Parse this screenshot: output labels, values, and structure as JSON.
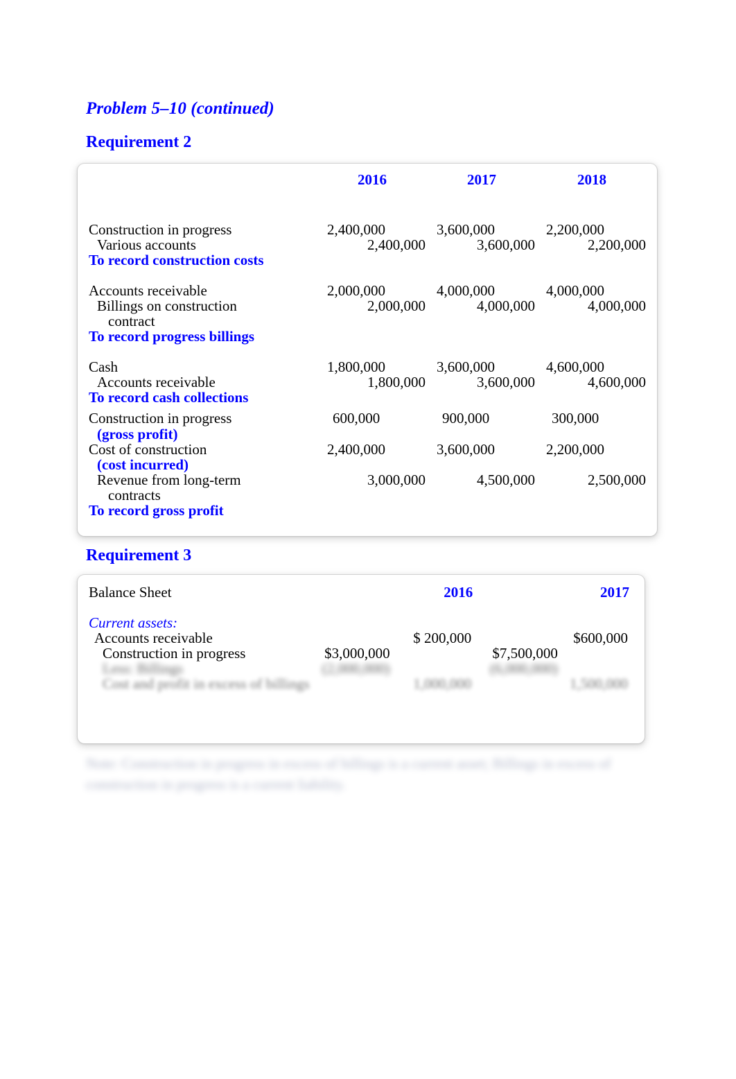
{
  "document": {
    "problem_title": "Problem 5–10 (continued)",
    "requirement2_heading": "Requirement 2",
    "requirement3_heading": "Requirement 3"
  },
  "requirement2": {
    "years": [
      "2016",
      "2017",
      "2018"
    ],
    "entries": [
      {
        "debit_account": "Construction in progress",
        "debit_values": [
          "2,400,000",
          "3,600,000",
          "2,200,000"
        ],
        "credit_account": "Various accounts",
        "credit_values": [
          "2,400,000",
          "3,600,000",
          "2,200,000"
        ],
        "memo": "To record construction costs"
      },
      {
        "debit_account": "Accounts receivable",
        "debit_values": [
          "2,000,000",
          "4,000,000",
          "4,000,000"
        ],
        "credit_account": "Billings on construction",
        "credit_account_line2": "contract",
        "credit_values": [
          "2,000,000",
          "4,000,000",
          "4,000,000"
        ],
        "memo": "To record progress billings"
      },
      {
        "debit_account": "Cash",
        "debit_values": [
          "1,800,000",
          "3,600,000",
          "4,600,000"
        ],
        "credit_account": "Accounts receivable",
        "credit_values": [
          "1,800,000",
          "3,600,000",
          "4,600,000"
        ],
        "memo": "To record cash collections"
      }
    ],
    "gross_profit_entry": {
      "debit_account_1": "Construction in progress",
      "debit_sublabel_1": "(gross profit)",
      "debit_values_1": [
        "600,000",
        "900,000",
        "300,000"
      ],
      "debit_account_2": "Cost of construction",
      "debit_sublabel_2": "(cost incurred)",
      "debit_values_2": [
        "2,400,000",
        "3,600,000",
        "2,200,000"
      ],
      "credit_account": "Revenue from long-term",
      "credit_account_line2": "contracts",
      "credit_values": [
        "3,000,000",
        "4,500,000",
        "2,500,000"
      ],
      "memo": "To record gross profit"
    }
  },
  "requirement3": {
    "statement_title": "Balance Sheet",
    "years": [
      "2016",
      "2017"
    ],
    "section_label": "Current assets:",
    "rows": [
      {
        "label": "Accounts receivable",
        "y2016_left": "",
        "y2016_right": "$ 200,000",
        "y2017_left": "",
        "y2017_right": "$600,000"
      },
      {
        "label": "Construction in progress",
        "y2016_left": "$3,000,000",
        "y2016_right": "",
        "y2017_left": "$7,500,000",
        "y2017_right": ""
      },
      {
        "label": "Less: Billings",
        "y2016_left": "(2,000,000)",
        "y2016_right": "",
        "y2017_left": "(6,000,000)",
        "y2017_right": "",
        "obscured": true
      },
      {
        "label": "Cost and profit in excess of billings",
        "y2016_left": "",
        "y2016_right": "1,000,000",
        "y2017_left": "",
        "y2017_right": "1,500,000",
        "obscured": true
      }
    ],
    "note": "Note: Construction in progress in excess of billings is a current asset; Billings in excess of construction in progress is a current liability.",
    "note_obscured": true
  },
  "colors": {
    "accent_blue": "#0000FF",
    "text_black": "#000000",
    "page_background": "#FFFFFF",
    "frame_border": "#BEBEBE"
  }
}
